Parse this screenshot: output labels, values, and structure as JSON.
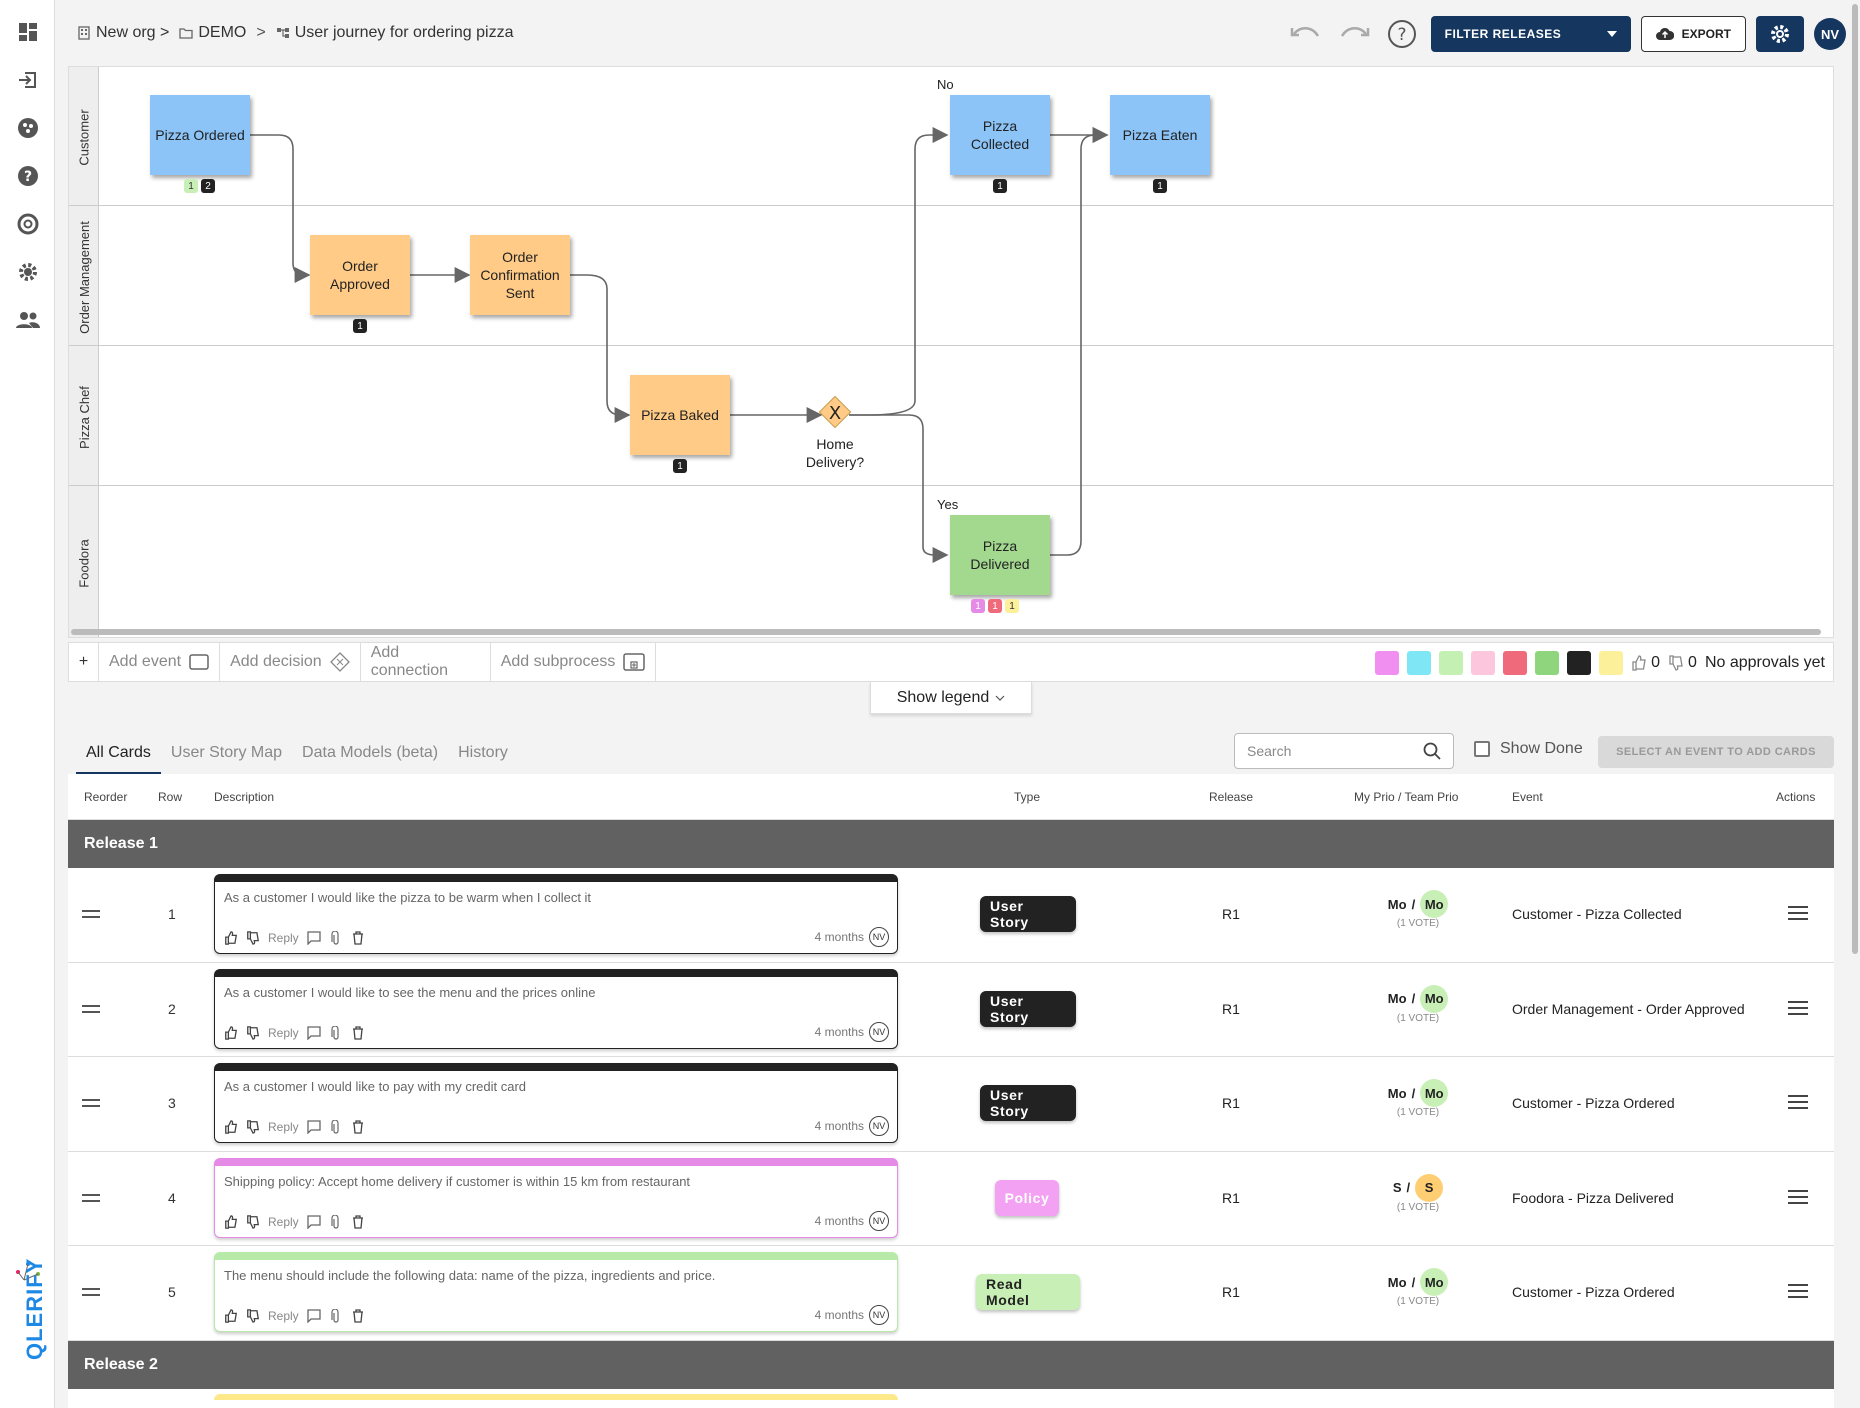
{
  "breadcrumb": {
    "org": "New org >",
    "folder": "DEMO",
    "sep": ">",
    "process": "User journey for ordering pizza"
  },
  "topbar": {
    "filter_label": "FILTER RELEASES",
    "export_label": "EXPORT",
    "avatar": "NV"
  },
  "lanes": [
    "Customer",
    "Order Management",
    "Pizza Chef",
    "Foodora"
  ],
  "nodes": {
    "pizza_ordered": "Pizza Ordered",
    "order_approved": "Order Approved",
    "order_confirmation": "Order Confirmation Sent",
    "pizza_baked": "Pizza Baked",
    "pizza_collected": "Pizza Collected",
    "pizza_eaten": "Pizza Eaten",
    "pizza_delivered": "Pizza Delivered",
    "gateway": "Home Delivery?",
    "gateway_symbol": "X",
    "label_no": "No",
    "label_yes": "Yes"
  },
  "badges": {
    "pizza_ordered": [
      "1",
      "2"
    ],
    "order_approved": [
      "1"
    ],
    "pizza_baked": [
      "1"
    ],
    "pizza_collected": [
      "1"
    ],
    "pizza_eaten": [
      "1"
    ],
    "pizza_delivered": [
      "1",
      "1",
      "1"
    ]
  },
  "toolbar": {
    "plus": "+",
    "add_event": "Add event",
    "add_decision": "Add decision",
    "add_connection": "Add connection",
    "add_subprocess": "Add subprocess",
    "likes": "0",
    "dislikes": "0",
    "approvals": "No approvals yet",
    "swatch_colors": [
      "#f08ff0",
      "#7fe6f5",
      "#c4f0b4",
      "#fcc6dc",
      "#ef6a7a",
      "#8fd57e",
      "#222222",
      "#fdf09a"
    ]
  },
  "legend_label": "Show legend",
  "tabs": [
    "All Cards",
    "User Story Map",
    "Data Models (beta)",
    "History"
  ],
  "search_placeholder": "Search",
  "show_done": "Show Done",
  "select_event_btn": "SELECT AN EVENT TO ADD CARDS",
  "columns": {
    "reorder": "Reorder",
    "row": "Row",
    "description": "Description",
    "type": "Type",
    "release": "Release",
    "prio": "My Prio / Team Prio",
    "event": "Event",
    "actions": "Actions"
  },
  "release1": "Release 1",
  "release2": "Release 2",
  "card_reply": "Reply",
  "rows": [
    {
      "num": "1",
      "text": "As a customer I would like the pizza to be warm when I collect it",
      "time": "4 months",
      "av": "NV",
      "type": "User Story",
      "release": "R1",
      "my_prio": "Mo",
      "slash": "/",
      "team_prio": "Mo",
      "votes": "(1 VOTE)",
      "event": "Customer - Pizza Collected"
    },
    {
      "num": "2",
      "text": "As a customer I would like to see the menu and the prices online",
      "time": "4 months",
      "av": "NV",
      "type": "User Story",
      "release": "R1",
      "my_prio": "Mo",
      "slash": "/",
      "team_prio": "Mo",
      "votes": "(1 VOTE)",
      "event": "Order Management - Order Approved"
    },
    {
      "num": "3",
      "text": "As a customer I would like to pay with my credit card",
      "time": "4 months",
      "av": "NV",
      "type": "User Story",
      "release": "R1",
      "my_prio": "Mo",
      "slash": "/",
      "team_prio": "Mo",
      "votes": "(1 VOTE)",
      "event": "Customer - Pizza Ordered"
    },
    {
      "num": "4",
      "text": "Shipping policy: Accept home delivery if customer is within 15 km from restaurant",
      "time": "4 months",
      "av": "NV",
      "type": "Policy",
      "release": "R1",
      "my_prio": "S",
      "slash": "/",
      "team_prio": "S",
      "votes": "(1 VOTE)",
      "event": "Foodora - Pizza Delivered"
    },
    {
      "num": "5",
      "text": "The menu should include the following data: name of the pizza, ingredients and price.",
      "time": "4 months",
      "av": "NV",
      "type": "Read Model",
      "release": "R1",
      "my_prio": "Mo",
      "slash": "/",
      "team_prio": "Mo",
      "votes": "(1 VOTE)",
      "event": "Customer - Pizza Ordered"
    }
  ],
  "brand": "QLERIFY"
}
